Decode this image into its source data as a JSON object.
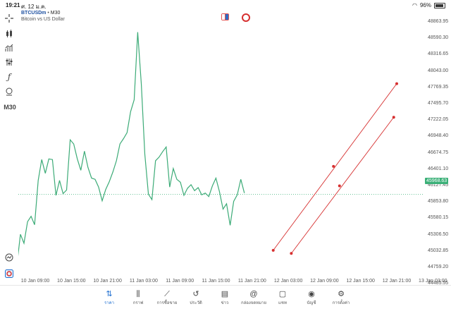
{
  "status_bar": {
    "time": "19:21",
    "date": "ศ. 12 ม.ค.",
    "battery": "96%"
  },
  "symbol": {
    "ticker": "BTCUSDm",
    "timeframe": "M30",
    "description": "Bitcoin vs US Dollar"
  },
  "toolbar": {
    "items": [
      "crosshair-icon",
      "candles-icon",
      "indicators-icon",
      "settings-icon",
      "function-icon",
      "objects-icon"
    ],
    "timeframe_label": "M30"
  },
  "price_axis": {
    "labels": [
      "48863.95",
      "48590.30",
      "48316.65",
      "48043.00",
      "47769.35",
      "47495.70",
      "47222.05",
      "46948.40",
      "46674.75",
      "46401.10",
      "46127.45",
      "45853.80",
      "45580.15",
      "45306.50",
      "45032.85",
      "44759.20",
      "44485.55"
    ],
    "current_price": "45968.63",
    "current_color": "#3bb078"
  },
  "time_axis": {
    "labels": [
      "10 Jan 09:00",
      "10 Jan 15:00",
      "10 Jan 21:00",
      "11 Jan 03:00",
      "11 Jan 09:00",
      "11 Jan 15:00",
      "11 Jan 21:00",
      "12 Jan 03:00",
      "12 Jan 09:00",
      "12 Jan 15:00",
      "12 Jan 21:00",
      "13 Jan 03:00"
    ]
  },
  "chart_data": {
    "type": "line",
    "series": [
      {
        "values": [
          45630,
          45720,
          45760,
          45650,
          45450,
          44780,
          45300,
          45150,
          45510,
          45600,
          45460,
          46200,
          46550,
          46320,
          46560,
          46550,
          45950,
          46200,
          45980,
          46040,
          46880,
          46810,
          46560,
          46370,
          46690,
          46420,
          46240,
          46220,
          46090,
          45860,
          46050,
          46180,
          46340,
          46530,
          46810,
          46900,
          47000,
          47350,
          47550,
          48680,
          47820,
          46640,
          45970,
          45880,
          46530,
          46590,
          46680,
          46760,
          46090,
          46400,
          46220,
          46170,
          45950,
          46070,
          46130,
          46030,
          46080,
          45960,
          45990,
          45930,
          46110,
          46240,
          46010,
          45720,
          45810,
          45450,
          45850,
          45960,
          46220,
          45990
        ],
        "color": "#3cab77"
      }
    ],
    "current_price": 45968.63,
    "ylim": [
      44400,
      49000
    ],
    "channel_lines": [
      {
        "from": [
          "12 Jan 00:30",
          45032
        ],
        "to": [
          "12 Jan 21:00",
          47819
        ],
        "mid": [
          "12 Jan 10:30",
          46436
        ],
        "color": "#d62f2f"
      },
      {
        "from": [
          "12 Jan 03:30",
          44980
        ],
        "to": [
          "12 Jan 20:30",
          47257
        ],
        "mid": [
          "12 Jan 11:30",
          46110
        ],
        "color": "#d62f2f"
      }
    ]
  },
  "bottom_nav": [
    {
      "label": "ราคา",
      "icon": "quotes-icon",
      "active": true
    },
    {
      "label": "กราฟ",
      "icon": "chart-icon",
      "active": false
    },
    {
      "label": "การซื้อขาย",
      "icon": "trade-icon",
      "active": false
    },
    {
      "label": "ประวัติ",
      "icon": "history-icon",
      "active": false
    },
    {
      "label": "ข่าว",
      "icon": "news-icon",
      "active": false
    },
    {
      "label": "กล่องจดหมาย",
      "icon": "mailbox-icon",
      "active": false
    },
    {
      "label": "แชท",
      "icon": "chat-icon",
      "active": false
    },
    {
      "label": "บัญชี",
      "icon": "account-icon",
      "active": false
    },
    {
      "label": "การตั้งค่า",
      "icon": "settings-gear-icon",
      "active": false
    }
  ]
}
